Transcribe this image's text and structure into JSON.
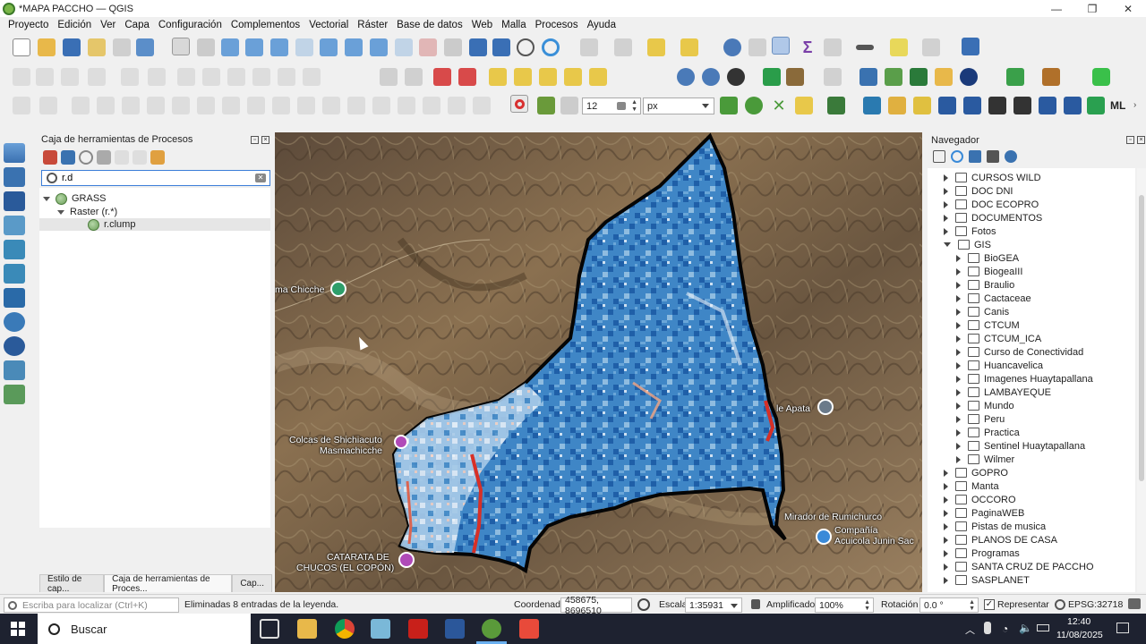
{
  "window": {
    "title": "*MAPA PACCHO — QGIS",
    "controls": [
      "minimize-icon",
      "maximize-icon",
      "close-icon"
    ]
  },
  "menu": [
    "Proyecto",
    "Edición",
    "Ver",
    "Capa",
    "Configuración",
    "Complementos",
    "Vectorial",
    "Ráster",
    "Base de datos",
    "Web",
    "Malla",
    "Procesos",
    "Ayuda"
  ],
  "snapping": {
    "tolerance": "12",
    "units": "px"
  },
  "processing": {
    "title": "Caja de herramientas de Procesos",
    "search_value": "r.d",
    "tree": {
      "provider": "GRASS",
      "group": "Raster (r.*)",
      "algorithm": "r.clump"
    },
    "tabs": [
      "Estilo de cap...",
      "Caja de herramientas de Proces...",
      "Cap..."
    ]
  },
  "map": {
    "labels": [
      "ma Chicche",
      "Colcas de Shichiacuto",
      "Masmachicche",
      "CATARATA DE",
      "CHUCOS (EL COPÓN)",
      "le Apata",
      "Mirador de Rumichurco",
      "Compañía",
      "Acuicola Junin Sac"
    ],
    "colors": {
      "water_dark": "#1f5fa8",
      "water_light": "#cfe1f2",
      "hot": "#d73027"
    }
  },
  "navigator": {
    "title": "Navegador",
    "items": [
      {
        "label": "CURSOS WILD",
        "level": 0,
        "expanded": false
      },
      {
        "label": "DOC DNI",
        "level": 0,
        "expanded": false
      },
      {
        "label": "DOC ECOPRO",
        "level": 0,
        "expanded": false
      },
      {
        "label": "DOCUMENTOS",
        "level": 0,
        "expanded": false
      },
      {
        "label": "Fotos",
        "level": 0,
        "expanded": false
      },
      {
        "label": "GIS",
        "level": 0,
        "expanded": true
      },
      {
        "label": "BioGEA",
        "level": 1,
        "expanded": false
      },
      {
        "label": "BiogeaIII",
        "level": 1,
        "expanded": false
      },
      {
        "label": "Braulio",
        "level": 1,
        "expanded": false
      },
      {
        "label": "Cactaceae",
        "level": 1,
        "expanded": false
      },
      {
        "label": "Canis",
        "level": 1,
        "expanded": false
      },
      {
        "label": "CTCUM",
        "level": 1,
        "expanded": false
      },
      {
        "label": "CTCUM_ICA",
        "level": 1,
        "expanded": false
      },
      {
        "label": "Curso de Conectividad",
        "level": 1,
        "expanded": false
      },
      {
        "label": "Huancavelica",
        "level": 1,
        "expanded": false
      },
      {
        "label": "Imagenes Huaytapallana",
        "level": 1,
        "expanded": false
      },
      {
        "label": "LAMBAYEQUE",
        "level": 1,
        "expanded": false
      },
      {
        "label": "Mundo",
        "level": 1,
        "expanded": false
      },
      {
        "label": "Peru",
        "level": 1,
        "expanded": false
      },
      {
        "label": "Practica",
        "level": 1,
        "expanded": false
      },
      {
        "label": "Sentinel Huaytapallana",
        "level": 1,
        "expanded": false
      },
      {
        "label": "Wilmer",
        "level": 1,
        "expanded": false
      },
      {
        "label": "GOPRO",
        "level": 0,
        "expanded": false
      },
      {
        "label": "Manta",
        "level": 0,
        "expanded": false
      },
      {
        "label": "OCCORO",
        "level": 0,
        "expanded": false
      },
      {
        "label": "PaginaWEB",
        "level": 0,
        "expanded": false
      },
      {
        "label": "Pistas de musica",
        "level": 0,
        "expanded": false
      },
      {
        "label": "PLANOS DE CASA",
        "level": 0,
        "expanded": false
      },
      {
        "label": "Programas",
        "level": 0,
        "expanded": false
      },
      {
        "label": "SANTA CRUZ DE PACCHO",
        "level": 0,
        "expanded": false
      },
      {
        "label": "SASPLANET",
        "level": 0,
        "expanded": false
      }
    ]
  },
  "statusbar": {
    "locator_placeholder": "Escriba para localizar (Ctrl+K)",
    "message": "Eliminadas 8 entradas de la leyenda.",
    "coord_label": "Coordenada",
    "coord_value": "458675, 8696510",
    "scale_label": "Escala",
    "scale_value": "1:35931",
    "magnifier_label": "Amplificador",
    "magnifier_value": "100%",
    "rotation_label": "Rotación",
    "rotation_value": "0.0 °",
    "render_label": "Representar",
    "crs": "EPSG:32718"
  },
  "taskbar": {
    "search_label": "Buscar",
    "time": "12:40",
    "date": "11/08/2025"
  }
}
